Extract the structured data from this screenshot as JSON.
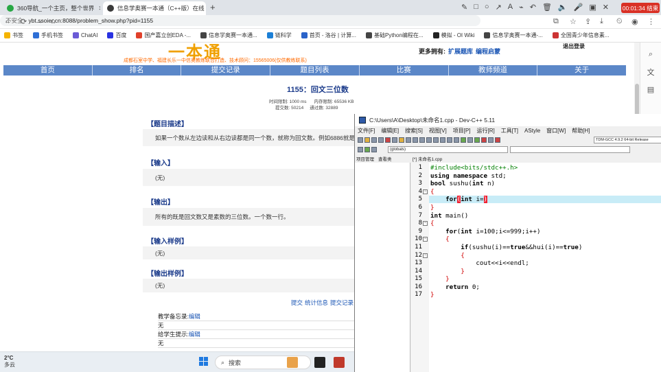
{
  "browser": {
    "tabs": [
      {
        "label": "360导航_一个主页，整个世界",
        "active": false
      },
      {
        "label": "信息学奥赛一本通（C++版）在线",
        "active": true
      },
      {
        "label": "ybt.ssoier.cn:8088/problem_show.php?pid=1155",
        "active": false
      }
    ],
    "url_warning": "不安全",
    "url": "ybt.ssoier.cn:8088/problem_show.php?pid=1155",
    "recording": "00:01:34 结束",
    "bookmarks": [
      "书签",
      "手机书签",
      "ChatAI",
      "百度",
      "国产嘉立创EDA -...",
      "信息学奥赛一本通...",
      "链科学",
      "首页 - 洛谷 | 计算...",
      "基础Python编程在...",
      "模拟 - OI Wiki",
      "信息学奥赛一本通-...",
      "全国青少年信息素..."
    ]
  },
  "site": {
    "logo_text": "一本通",
    "logo_sub": "成都石室中学、福建长乐一中信奥教练联合打造、技术顾问：15565006(仅供教练联系)",
    "more_label": "更多拥有:",
    "more_links": [
      "扩展题库",
      "编程启蒙"
    ],
    "signin": "退出登录",
    "nav": [
      "首页",
      "排名",
      "提交记录",
      "题目列表",
      "比赛",
      "教师频道",
      "关于"
    ]
  },
  "problem": {
    "title": "1155：回文三位数",
    "time_limit": "时间限制: 1000 ms",
    "mem_limit": "内存限制: 65536 KB",
    "submits": "提交数: 50214",
    "passes": "通过数: 32889",
    "sections": [
      {
        "heading": "【题目描述】",
        "content": "如果一个数从左边读和从右边读都是同一个数，就称为回文数。例如6886就是一"
      },
      {
        "heading": "【输入】",
        "content": "(无)"
      },
      {
        "heading": "【输出】",
        "content": "所有的既是回文数又是素数的三位数。一个数一行。"
      },
      {
        "heading": "【输入样例】",
        "content": "(无)"
      },
      {
        "heading": "【输出样例】",
        "content": "(无)"
      }
    ],
    "links": [
      "提交",
      "统计信息",
      "提交记录"
    ],
    "memo": {
      "teacher_label": "教学备忘录:",
      "teacher_link": "编辑",
      "teacher_value": "无",
      "student_label": "给学生提示:",
      "student_link": "编辑",
      "student_value": "无"
    }
  },
  "taskbar": {
    "temp": "2°C",
    "weather": "多云",
    "search": "搜索"
  },
  "devcpp": {
    "title": "C:\\Users\\A\\Desktop\\未命名1.cpp - Dev-C++ 5.11",
    "menu": [
      "文件[F]",
      "编辑[E]",
      "搜索[S]",
      "视图[V]",
      "项目[P]",
      "运行[R]",
      "工具[T]",
      "AStyle",
      "窗口[W]",
      "帮助[H]"
    ],
    "compiler": "TDM-GCC 4.9.2 64-bit Release",
    "globals": "(globals)",
    "project_tabs": [
      "项目管理",
      "查看类"
    ],
    "file_tab": "[*] 未命名1.cpp",
    "line_numbers": [
      "1",
      "2",
      "3",
      "4",
      "5",
      "6",
      "7",
      "8",
      "9",
      "10",
      "11",
      "12",
      "13",
      "14",
      "15",
      "16",
      "17"
    ]
  }
}
